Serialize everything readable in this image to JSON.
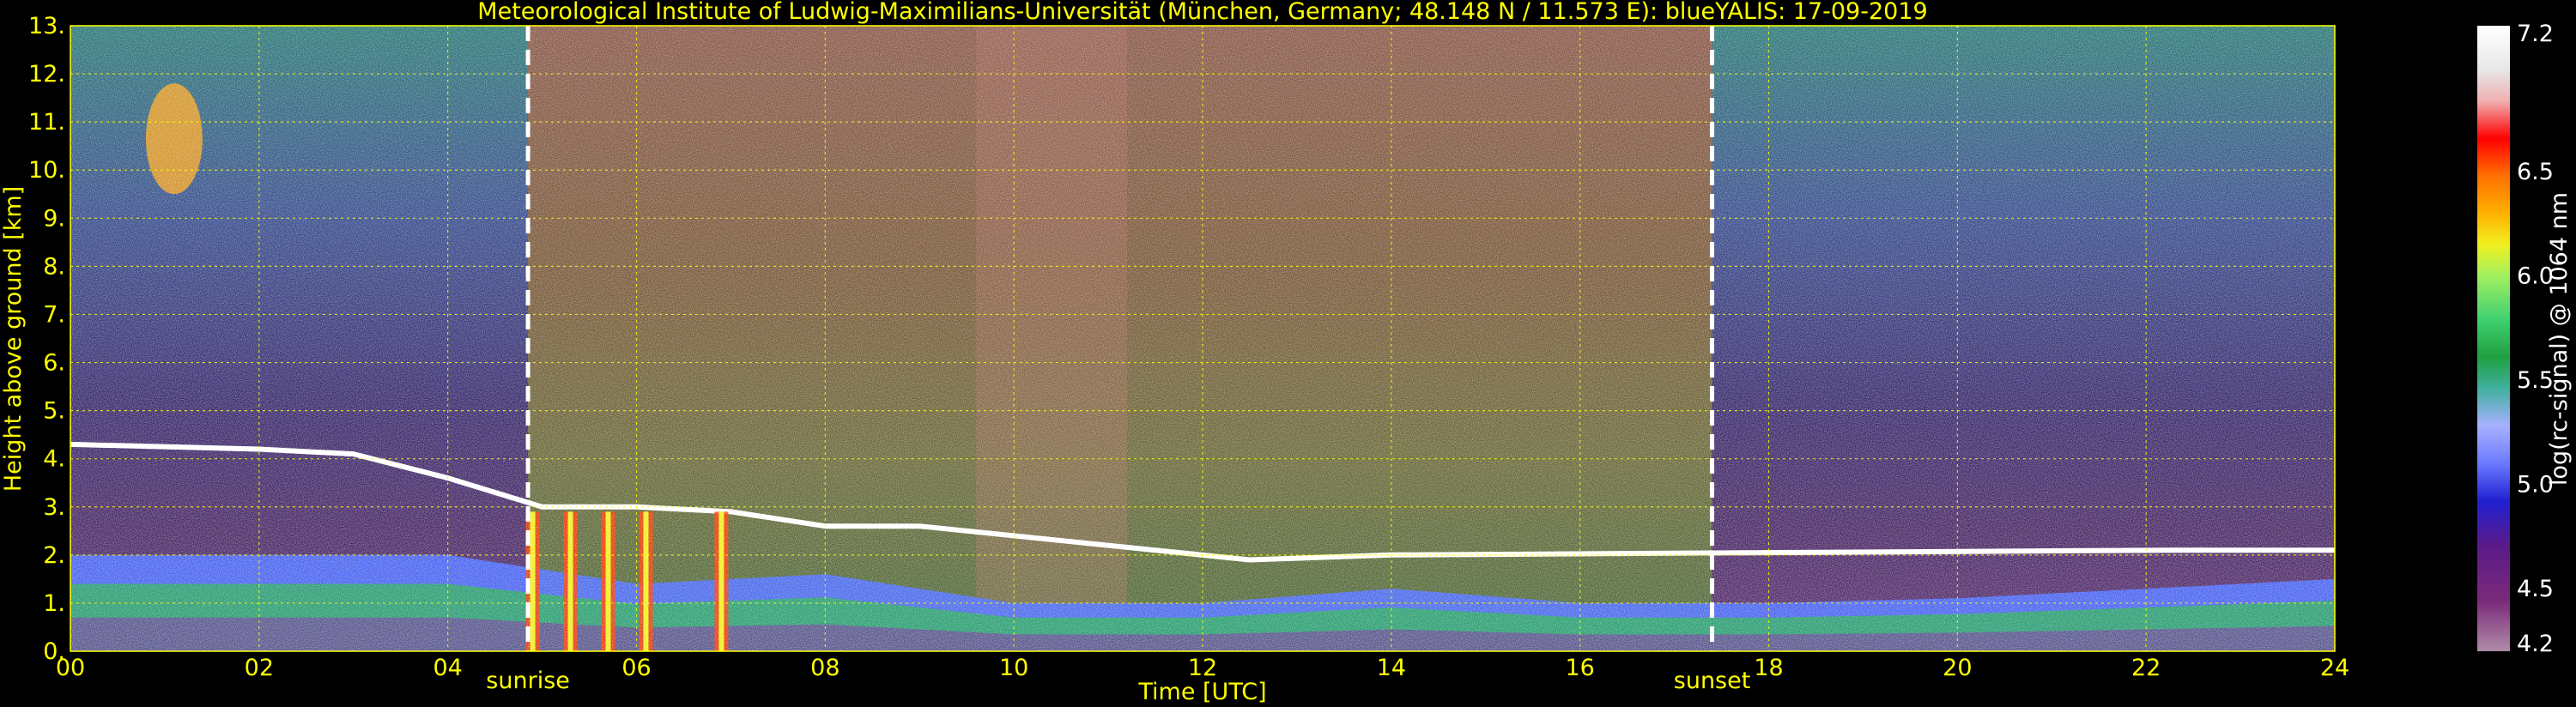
{
  "chart_data": {
    "type": "heatmap",
    "title": "Meteorological Institute of Ludwig-Maximilians-Universität (München, Germany; 48.148 N / 11.573 E):    blueYALIS: 17-09-2019",
    "xlabel": "Time [UTC]",
    "ylabel": "Height above ground [km]",
    "xlim": [
      0,
      24
    ],
    "ylim": [
      0,
      13
    ],
    "x_ticks": [
      "00",
      "02",
      "04",
      "06",
      "08",
      "10",
      "12",
      "14",
      "16",
      "18",
      "20",
      "22",
      "24"
    ],
    "x_tick_values": [
      0,
      2,
      4,
      6,
      8,
      10,
      12,
      14,
      16,
      18,
      20,
      22,
      24
    ],
    "y_ticks": [
      "0.",
      "1.",
      "2.",
      "3.",
      "4.",
      "5.",
      "6.",
      "7.",
      "8.",
      "9.",
      "10.",
      "11.",
      "12.",
      "13."
    ],
    "y_tick_values": [
      0,
      1,
      2,
      3,
      4,
      5,
      6,
      7,
      8,
      9,
      10,
      11,
      12,
      13
    ],
    "grid": true,
    "annotations": [
      {
        "text": "sunrise",
        "x": 4.85
      },
      {
        "text": "sunset",
        "x": 17.4
      }
    ],
    "colorbar": {
      "label": "log(rc-signal) @ 1064 nm",
      "range": [
        4.2,
        7.2
      ],
      "ticks": [
        "4.2",
        "4.5",
        "5.0",
        "5.5",
        "6.0",
        "6.5",
        "7.2"
      ],
      "tick_values": [
        4.2,
        4.5,
        5.0,
        5.5,
        6.0,
        6.5,
        7.2
      ]
    },
    "features": {
      "aerosol_layer_top_km": [
        [
          0,
          2.0
        ],
        [
          2,
          2.0
        ],
        [
          4,
          2.0
        ],
        [
          6,
          1.4
        ],
        [
          8,
          1.6
        ],
        [
          10,
          1.0
        ],
        [
          12,
          1.0
        ],
        [
          14,
          1.3
        ],
        [
          16,
          1.0
        ],
        [
          18,
          1.0
        ],
        [
          20,
          1.1
        ],
        [
          22,
          1.3
        ],
        [
          24,
          1.5
        ]
      ],
      "cloud_layer_km": [
        [
          0,
          4.3
        ],
        [
          2,
          4.2
        ],
        [
          3,
          4.1
        ],
        [
          4,
          3.6
        ],
        [
          5,
          3.0
        ],
        [
          6,
          3.0
        ],
        [
          7,
          2.9
        ],
        [
          8,
          2.6
        ],
        [
          9,
          2.6
        ],
        [
          12.5,
          1.9
        ],
        [
          14,
          2.0
        ],
        [
          22.3,
          2.1
        ],
        [
          24,
          2.1
        ]
      ],
      "cirrus_cloud_km": {
        "x": [
          0.8,
          1.4
        ],
        "y": [
          9.5,
          11.8
        ]
      },
      "convective_clouds_hours": [
        4.9,
        5.3,
        5.7,
        6.1,
        6.9
      ]
    },
    "colors": {
      "axis_text": "#ffff00",
      "colorbar_text": "#ffffff",
      "grid": "#ffff00",
      "sun_line": "#ffffff"
    }
  }
}
